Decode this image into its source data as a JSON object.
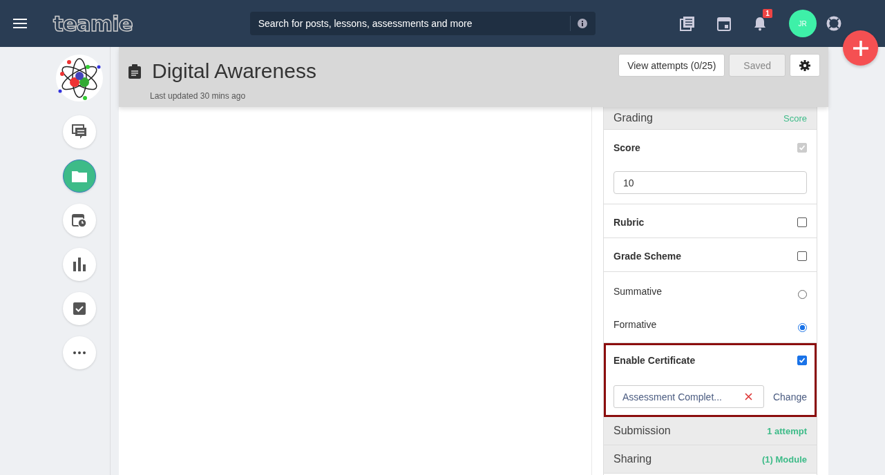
{
  "topbar": {
    "logo": "teamie",
    "search": {
      "placeholder": "Search for posts, lessons, assessments and more"
    },
    "notification_count": "1",
    "avatar": "JR"
  },
  "sidebar": {
    "items": [
      {
        "kind": "chat",
        "selected": false
      },
      {
        "kind": "folder",
        "selected": true
      },
      {
        "kind": "schedule",
        "selected": false
      },
      {
        "kind": "chart",
        "selected": false
      },
      {
        "kind": "check",
        "selected": false
      },
      {
        "kind": "more",
        "selected": false
      }
    ]
  },
  "header": {
    "title": "Digital Awareness",
    "subtitle": "Last updated 30 mins ago",
    "buttons": [
      {
        "label": "View attempts (0/25)",
        "disabled": false
      },
      {
        "label": "Saved",
        "disabled": true
      }
    ]
  },
  "grading": {
    "title": "Grading",
    "summary": "Score",
    "options": [
      {
        "label": "Score",
        "checked": true,
        "disabled": true,
        "value": "10"
      },
      {
        "label": "Rubric",
        "checked": false,
        "disabled": false
      },
      {
        "label": "Grade Scheme",
        "checked": false,
        "disabled": false
      }
    ],
    "types": [
      {
        "label": "Summative",
        "selected": false
      },
      {
        "label": "Formative",
        "selected": true
      }
    ],
    "certificate": {
      "label": "Enable Certificate",
      "checked": true,
      "highlighted": true,
      "file": "Assessment Complet...",
      "action": "Change"
    }
  },
  "sections": [
    {
      "title": "Submission",
      "summary": "1 attempt"
    },
    {
      "title": "Sharing",
      "summary": "(1) Module"
    }
  ]
}
